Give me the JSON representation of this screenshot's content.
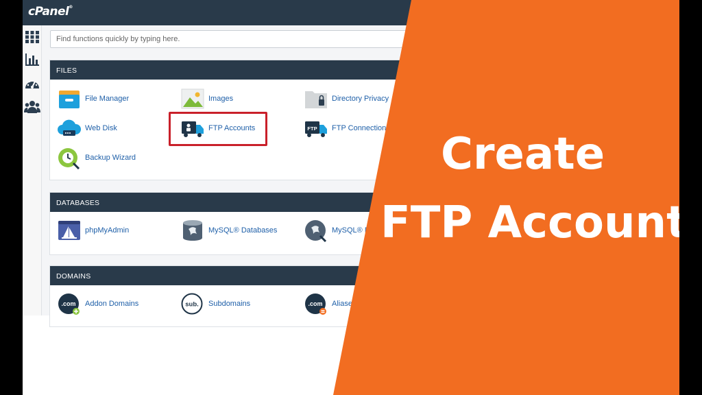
{
  "brand": {
    "logo_text": "cPanel",
    "trademark": "®"
  },
  "search": {
    "placeholder": "Find functions quickly by typing here."
  },
  "sidebar": {
    "icons": [
      "apps-grid-icon",
      "bar-chart-icon",
      "dashboard-gauge-icon",
      "users-icon"
    ]
  },
  "files": {
    "title": "FILES",
    "items": [
      {
        "label": "File Manager",
        "icon": "file-manager-icon"
      },
      {
        "label": "Images",
        "icon": "images-icon"
      },
      {
        "label": "Directory Privacy",
        "icon": "directory-privacy-icon"
      },
      {
        "label": "Web Disk",
        "icon": "web-disk-icon"
      },
      {
        "label": "FTP Accounts",
        "icon": "ftp-accounts-icon"
      },
      {
        "label": "FTP Connections",
        "icon": "ftp-connections-icon"
      },
      {
        "label": "Backup Wizard",
        "icon": "backup-wizard-icon"
      }
    ]
  },
  "databases": {
    "title": "DATABASES",
    "items": [
      {
        "label": "phpMyAdmin",
        "icon": "phpmyadmin-icon"
      },
      {
        "label": "MySQL® Databases",
        "icon": "mysql-databases-icon"
      },
      {
        "label": "MySQL® D",
        "icon": "mysql-wizard-icon"
      }
    ]
  },
  "domains": {
    "title": "DOMAINS",
    "items": [
      {
        "label": "Addon Domains",
        "icon": "addon-domains-icon",
        "badge": ".com"
      },
      {
        "label": "Subdomains",
        "icon": "subdomains-icon",
        "badge": "sub."
      },
      {
        "label": "Aliase",
        "icon": "aliases-icon",
        "badge": ".com"
      }
    ]
  },
  "overlay": {
    "line1": "Create",
    "line2": "FTP Account",
    "color": "#f26d21"
  },
  "colors": {
    "topbar": "#293a4a",
    "link": "#1e5fa8",
    "highlight": "#c9202a"
  }
}
